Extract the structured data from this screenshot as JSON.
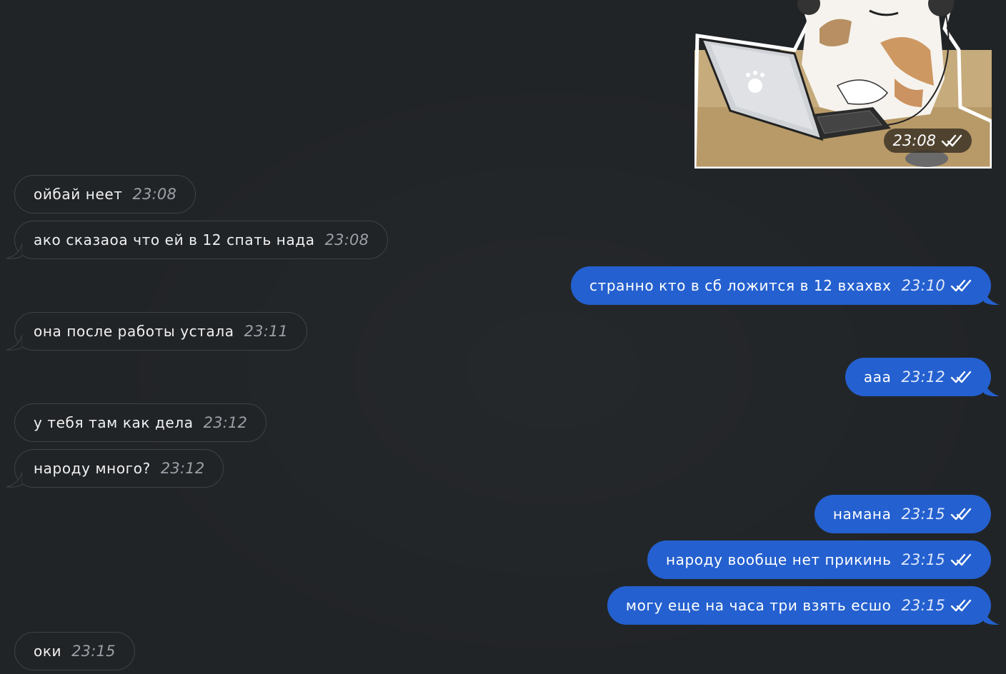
{
  "sticker": {
    "alt": "cat-with-laptop-sticker",
    "time": "23:08",
    "status": "read"
  },
  "messages": [
    {
      "direction": "in",
      "text": "ойбай неет",
      "time": "23:08"
    },
    {
      "direction": "in",
      "text": "ако сказаоа что ей в 12 спать нада",
      "time": "23:08"
    },
    {
      "direction": "out",
      "text": "странно кто в сб ложится в 12 вхахвх",
      "time": "23:10",
      "status": "read"
    },
    {
      "direction": "in",
      "text": "она после работы устала",
      "time": "23:11"
    },
    {
      "direction": "out",
      "text": "ааа",
      "time": "23:12",
      "status": "read"
    },
    {
      "direction": "in",
      "text": "у тебя там как дела",
      "time": "23:12"
    },
    {
      "direction": "in",
      "text": "народу много?",
      "time": "23:12"
    },
    {
      "direction": "out",
      "text": "намана",
      "time": "23:15",
      "status": "read"
    },
    {
      "direction": "out",
      "text": "народу вообще нет прикинь",
      "time": "23:15",
      "status": "read"
    },
    {
      "direction": "out",
      "text": "могу еще на часа три взять есшо",
      "time": "23:15",
      "status": "read"
    },
    {
      "direction": "in",
      "text": "оки",
      "time": "23:15"
    }
  ],
  "colors": {
    "background": "#212427",
    "outgoing_bubble": "#2460cf",
    "incoming_border": "#3e4246"
  }
}
